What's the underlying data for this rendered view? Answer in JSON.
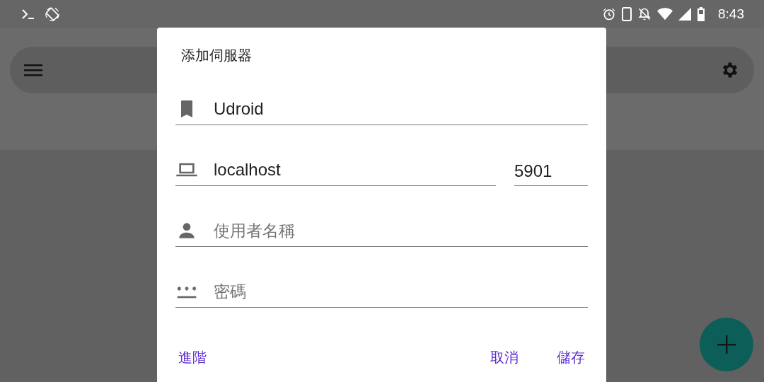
{
  "status_bar": {
    "time": "8:43"
  },
  "dialog": {
    "title": "添加伺服器",
    "rows": [
      {
        "kind": "name",
        "fields": [
          {
            "value": "Udroid"
          }
        ]
      },
      {
        "kind": "host",
        "fields": [
          {
            "value": "localhost"
          },
          {
            "value": "5901"
          }
        ]
      },
      {
        "kind": "user",
        "fields": [
          {
            "placeholder": "使用者名稱"
          }
        ]
      },
      {
        "kind": "password",
        "fields": [
          {
            "placeholder": "密碼"
          }
        ]
      }
    ],
    "left_buttons": [
      "進階"
    ],
    "right_buttons": [
      "取消",
      "儲存"
    ]
  }
}
